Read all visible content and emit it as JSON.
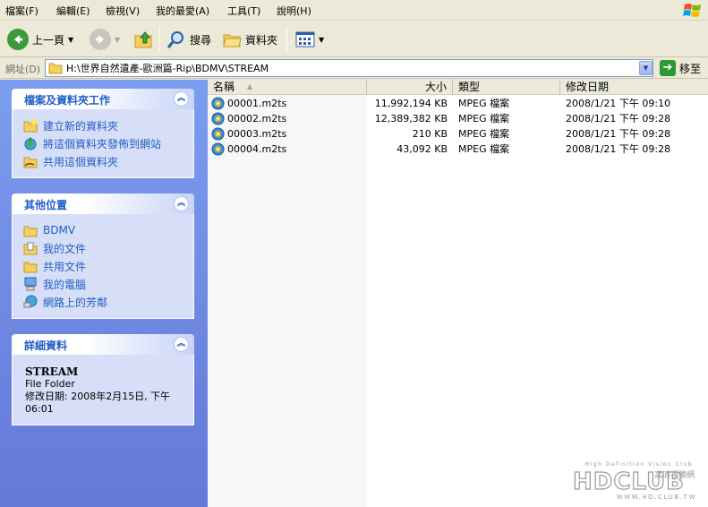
{
  "menubar": {
    "items": [
      "檔案(F)",
      "編輯(E)",
      "檢視(V)",
      "我的最愛(A)",
      "工具(T)",
      "說明(H)"
    ]
  },
  "toolbar": {
    "back_label": "上一頁",
    "search_label": "搜尋",
    "folders_label": "資料夾"
  },
  "address": {
    "label": "網址(D)",
    "path": "H:\\世界自然遺產-歐洲篇-Rip\\BDMV\\STREAM",
    "go_label": "移至"
  },
  "taskpane": {
    "file_tasks": {
      "title": "檔案及資料夾工作",
      "items": [
        {
          "label": "建立新的資料夾",
          "icon": "new-folder-icon"
        },
        {
          "label": "將這個資料夾發佈到網站",
          "icon": "publish-web-icon"
        },
        {
          "label": "共用這個資料夾",
          "icon": "share-folder-icon"
        }
      ]
    },
    "other_places": {
      "title": "其他位置",
      "items": [
        {
          "label": "BDMV",
          "icon": "folder-icon"
        },
        {
          "label": "我的文件",
          "icon": "my-documents-icon"
        },
        {
          "label": "共用文件",
          "icon": "shared-documents-icon"
        },
        {
          "label": "我的電腦",
          "icon": "my-computer-icon"
        },
        {
          "label": "網路上的芳鄰",
          "icon": "network-places-icon"
        }
      ]
    },
    "details": {
      "title": "詳細資料",
      "name": "STREAM",
      "kind": "File Folder",
      "modified_line1": "修改日期: 2008年2月15日, 下午",
      "modified_line2": "06:01"
    }
  },
  "filelist": {
    "columns": {
      "name": "名稱",
      "size": "大小",
      "type": "類型",
      "date": "修改日期"
    },
    "rows": [
      {
        "name": "00001.m2ts",
        "size": "11,992,194 KB",
        "type": "MPEG 檔案",
        "date": "2008/1/21 下午 09:10"
      },
      {
        "name": "00002.m2ts",
        "size": "12,389,382 KB",
        "type": "MPEG 檔案",
        "date": "2008/1/21 下午 09:28"
      },
      {
        "name": "00003.m2ts",
        "size": "210 KB",
        "type": "MPEG 檔案",
        "date": "2008/1/21 下午 09:28"
      },
      {
        "name": "00004.m2ts",
        "size": "43,092 KB",
        "type": "MPEG 檔案",
        "date": "2008/1/21 下午 09:28"
      }
    ]
  },
  "watermark": {
    "tagline": "High Definition Vision Club",
    "logo": "HDCLUB",
    "chinese": "高清視聽網",
    "url": "WWW.HD.CLUB.TW"
  },
  "colors": {
    "taskpane_top": "#7b9df0",
    "taskpane_bottom": "#6478d8",
    "task_link": "#215dc6",
    "panel_body": "#d6dff7"
  }
}
